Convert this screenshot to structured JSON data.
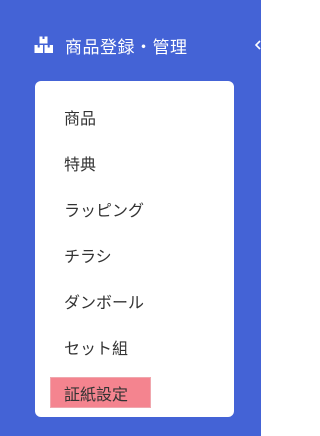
{
  "section": {
    "label": "商品登録・管理",
    "icon": "boxes-icon"
  },
  "submenu": {
    "items": [
      {
        "label": "商品",
        "active": false
      },
      {
        "label": "特典",
        "active": false
      },
      {
        "label": "ラッピング",
        "active": false
      },
      {
        "label": "チラシ",
        "active": false
      },
      {
        "label": "ダンボール",
        "active": false
      },
      {
        "label": "セット組",
        "active": false
      },
      {
        "label": "証紙設定",
        "active": true
      }
    ]
  },
  "colors": {
    "sidebar_bg": "#4463d6",
    "panel_bg": "#ffffff",
    "active_highlight": "#f4848f",
    "item_text": "#333333"
  }
}
